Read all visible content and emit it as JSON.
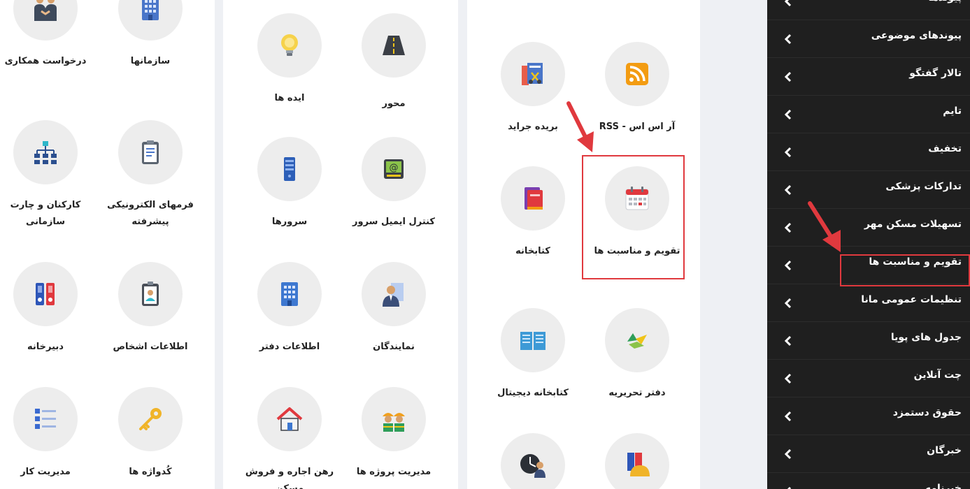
{
  "panel_left": {
    "tiles": [
      {
        "label": "سازمانها",
        "icon": "building-icon"
      },
      {
        "label": "درخواست همکاری",
        "icon": "handshake-people-icon"
      },
      {
        "label": "فرمهای الکترونیکی پیشرفته",
        "icon": "clipboard-form-icon"
      },
      {
        "label": "کارکنان و چارت سازمانی",
        "icon": "org-chart-icon"
      },
      {
        "label": "اطلاعات اشخاص",
        "icon": "id-badge-icon"
      },
      {
        "label": "دبیرخانه",
        "icon": "binders-icon"
      },
      {
        "label": "کُدواژه ها",
        "icon": "key-icon"
      },
      {
        "label": "مدیریت کار",
        "icon": "task-list-icon"
      }
    ]
  },
  "panel_middle": {
    "tiles": [
      {
        "label": "محور",
        "icon": "road-icon"
      },
      {
        "label": "ایده ها",
        "icon": "lightbulb-icon"
      },
      {
        "label": "کنترل ایمیل سرور",
        "icon": "email-server-icon"
      },
      {
        "label": "سرورها",
        "icon": "server-icon"
      },
      {
        "label": "نمایندگان",
        "icon": "representative-icon"
      },
      {
        "label": "اطلاعات دفتر",
        "icon": "office-building-icon"
      },
      {
        "label": "مدیریت پروژه ها",
        "icon": "workers-icon"
      },
      {
        "label": "رهن اجاره و فروش مسکن",
        "icon": "house-icon"
      }
    ]
  },
  "panel_right": {
    "tiles": [
      {
        "label": "آر اس اس - RSS",
        "icon": "rss-icon"
      },
      {
        "label": "بریده جراید",
        "icon": "newspaper-clipping-icon"
      },
      {
        "label": "تقویم و مناسبت ها",
        "icon": "calendar-icon"
      },
      {
        "label": "کتابخانه",
        "icon": "books-icon"
      },
      {
        "label": "دفتر تحریریه",
        "icon": "editorial-icon"
      },
      {
        "label": "کتابخانه دیجیتال",
        "icon": "digital-library-icon"
      },
      {
        "label": "",
        "icon": "binder-helmet-icon"
      },
      {
        "label": "",
        "icon": "clock-person-icon"
      }
    ]
  },
  "menu": {
    "items": [
      "پیوندها",
      "پیوندهای موضوعی",
      "تالار گفتگو",
      "تایم",
      "تخفیف",
      "تدارکات پزشکی",
      "تسهیلات مسکن مهر",
      "تقویم و مناسبت ها",
      "تنظیمات عمومی مانا",
      "جدول های پویا",
      "چت آنلاین",
      "حقوق دستمزد",
      "خبرگان",
      "خبرنامه"
    ],
    "highlighted_index": 7
  },
  "colors": {
    "highlight": "#e0393e",
    "menu_bg": "#1f1f1f",
    "icon_circle": "#ededed"
  }
}
